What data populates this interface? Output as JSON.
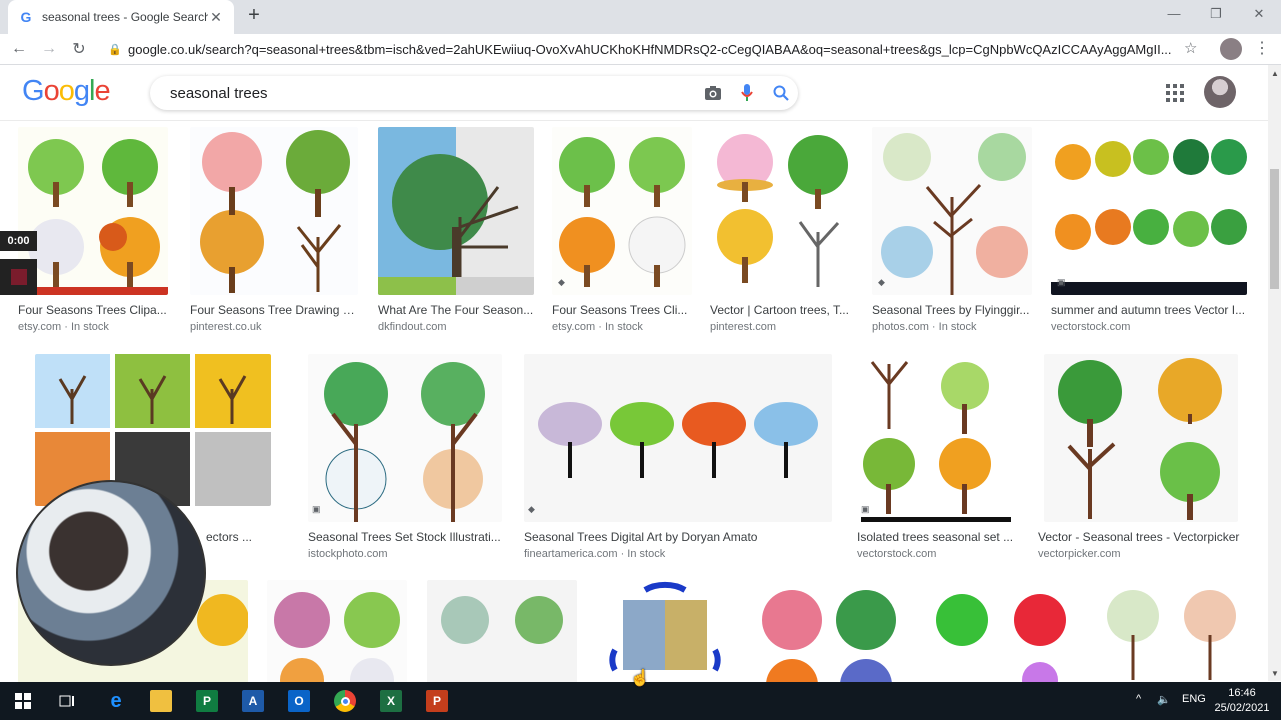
{
  "browser": {
    "tab_title": "seasonal trees - Google Search",
    "tab_favicon": "G",
    "new_tab_label": "+",
    "url": "google.co.uk/search?q=seasonal+trees&tbm=isch&ved=2ahUKEwiiuq-OvoXvAhUCKhoKHfNMDRsQ2-cCegQIABAA&oq=seasonal+trees&gs_lcp=CgNpbWcQAzICCAAyAggAMgII..."
  },
  "google": {
    "logo_letters": [
      {
        "ch": "G",
        "color": "#4285f4"
      },
      {
        "ch": "o",
        "color": "#ea4335"
      },
      {
        "ch": "o",
        "color": "#fbbc05"
      },
      {
        "ch": "g",
        "color": "#4285f4"
      },
      {
        "ch": "l",
        "color": "#34a853"
      },
      {
        "ch": "e",
        "color": "#ea4335"
      }
    ],
    "query": "seasonal trees"
  },
  "results": [
    {
      "caption": "Four Seasons Trees Clipa...",
      "source": "etsy.com · In stock"
    },
    {
      "caption": "Four Seasons Tree Drawing Sa...",
      "source": "pinterest.co.uk"
    },
    {
      "caption": "What Are The Four Season...",
      "source": "dkfindout.com"
    },
    {
      "caption": "Four Seasons Trees Cli...",
      "source": "etsy.com · In stock"
    },
    {
      "caption": "Vector | Cartoon trees, T...",
      "source": "pinterest.com"
    },
    {
      "caption": "Seasonal Trees by Flyinggir...",
      "source": "photos.com · In stock"
    },
    {
      "caption": "summer and autumn trees Vector I...",
      "source": "vectorstock.com"
    },
    {
      "caption": "ectors ...",
      "source": ""
    },
    {
      "caption": "Seasonal Trees Set Stock Illustrati...",
      "source": "istockphoto.com"
    },
    {
      "caption": "Seasonal Trees Digital Art by Doryan Amato",
      "source": "fineartamerica.com · In stock"
    },
    {
      "caption": "Isolated trees seasonal set ...",
      "source": "vectorstock.com"
    },
    {
      "caption": "Vector - Seasonal trees - Vectorpicker",
      "source": "vectorpicker.com"
    }
  ],
  "overlay": {
    "timer": "0:00"
  },
  "taskbar": {
    "language": "ENG",
    "time": "16:46",
    "date": "25/02/2021"
  }
}
